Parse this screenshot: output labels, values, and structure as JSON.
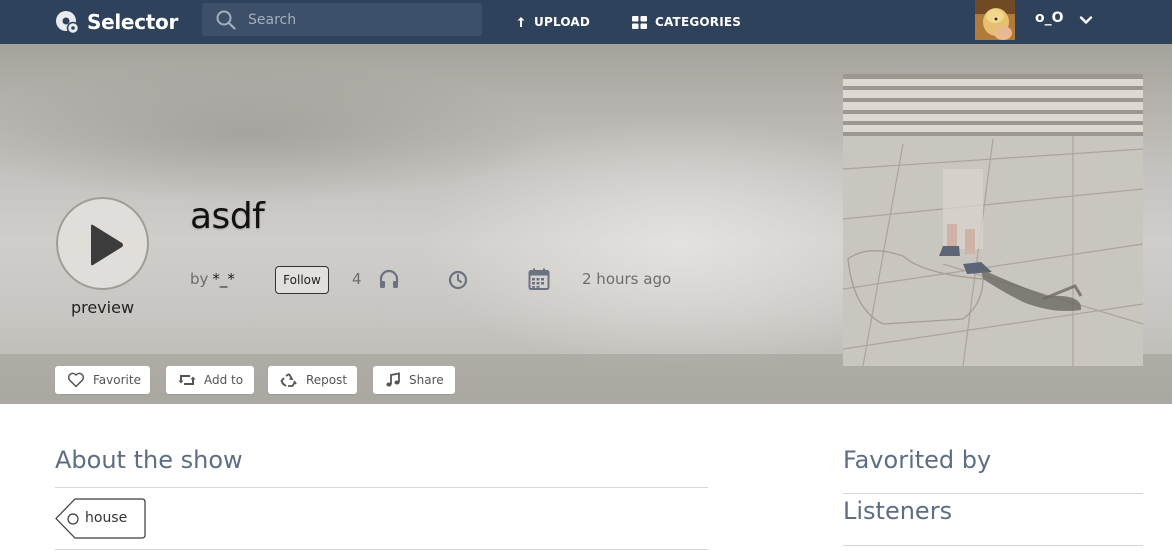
{
  "header": {
    "app_name": "Selector",
    "search": {
      "placeholder": "Search",
      "value": ""
    },
    "nav": {
      "upload": "UPLOAD",
      "categories": "CATEGORIES"
    },
    "user": {
      "name": "o_O"
    }
  },
  "track": {
    "title": "asdf",
    "preview_label": "preview",
    "by_label": "by",
    "author": "*_*",
    "follow_label": "Follow",
    "plays": "4",
    "posted": "2 hours ago"
  },
  "actions": {
    "favorite": "Favorite",
    "add_to": "Add to",
    "repost": "Repost",
    "share": "Share"
  },
  "about": {
    "title": "About the show",
    "tags": [
      "house"
    ]
  },
  "sidebar": {
    "favorited_by": "Favorited by",
    "listeners": "Listeners"
  },
  "colors": {
    "header_bg": "#2f425c",
    "section_title": "#5d6e84"
  }
}
